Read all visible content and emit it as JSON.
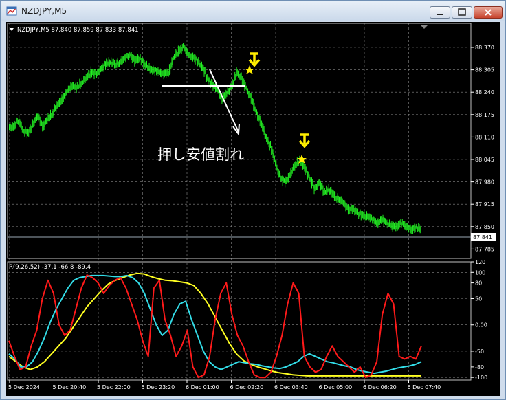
{
  "window": {
    "title": "NZDJPY,M5"
  },
  "main_chart": {
    "ohlc_label": "NZDJPY,M5  87.840 87.859 87.833 87.841",
    "current_price_label": "87.841",
    "price_ticks": [
      "88.370",
      "88.305",
      "88.240",
      "88.175",
      "88.110",
      "88.045",
      "87.980",
      "87.915",
      "87.850",
      "87.785"
    ],
    "annotation_text": "押し安値割れ",
    "colors": {
      "candle": "#22ee22",
      "marker": "#ffff00",
      "grid": "#8a8a8a",
      "annotation": "#ffffff"
    }
  },
  "indicator": {
    "label": "R(9,26,52) -37.1 -66.8 -89.4",
    "ticks": [
      "120",
      "100",
      "80",
      "50",
      "0.00",
      "-50",
      "-80",
      "-100"
    ],
    "colors": {
      "fast": "#ff1a1a",
      "mid": "#33dde8",
      "slow": "#ffff22"
    }
  },
  "time_axis": [
    "5 Dec 2024",
    "5 Dec 20:40",
    "5 Dec 22:00",
    "5 Dec 23:20",
    "6 Dec 01:00",
    "6 Dec 02:20",
    "6 Dec 03:40",
    "6 Dec 05:00",
    "6 Dec 06:20",
    "6 Dec 07:40"
  ],
  "chart_data": {
    "type": "candlestick",
    "title": "NZDJPY,M5",
    "price_range": [
      87.785,
      88.4
    ],
    "close_series": [
      88.14,
      88.16,
      88.13,
      88.12,
      88.15,
      88.17,
      88.14,
      88.16,
      88.18,
      88.2,
      88.22,
      88.24,
      88.26,
      88.25,
      88.27,
      88.28,
      88.3,
      88.29,
      88.31,
      88.32,
      88.33,
      88.32,
      88.33,
      88.34,
      88.35,
      88.33,
      88.34,
      88.32,
      88.31,
      88.3,
      88.3,
      88.29,
      88.3,
      88.34,
      88.36,
      88.37,
      88.35,
      88.34,
      88.33,
      88.31,
      88.28,
      88.26,
      88.25,
      88.22,
      88.24,
      88.26,
      88.3,
      88.28,
      88.25,
      88.22,
      88.18,
      88.15,
      88.11,
      88.08,
      88.03,
      87.99,
      87.98,
      88.0,
      88.03,
      88.04,
      88.02,
      87.99,
      87.96,
      87.98,
      87.95,
      87.96,
      87.94,
      87.93,
      87.92,
      87.9,
      87.9,
      87.89,
      87.88,
      87.88,
      87.87,
      87.86,
      87.87,
      87.86,
      87.85,
      87.85,
      87.86,
      87.85,
      87.84,
      87.85,
      87.84
    ],
    "oscillator_range": [
      -105,
      120
    ],
    "series": [
      {
        "name": "R(9)",
        "values": [
          -30,
          -60,
          -85,
          -80,
          -40,
          -10,
          50,
          85,
          60,
          0,
          -20,
          -10,
          30,
          70,
          95,
          90,
          80,
          60,
          75,
          85,
          90,
          70,
          40,
          10,
          -30,
          -60,
          70,
          85,
          10,
          -20,
          -60,
          -40,
          -10,
          -80,
          -100,
          -95,
          -60,
          10,
          60,
          80,
          20,
          -20,
          -40,
          -70,
          -95,
          -100,
          -100,
          -90,
          -60,
          -20,
          40,
          80,
          60,
          -60,
          -80,
          -90,
          -85,
          -60,
          -40,
          -60,
          -70,
          -80,
          -90,
          -80,
          -100,
          -95,
          -70,
          20,
          60,
          40,
          -60,
          -65,
          -60,
          -65,
          -40
        ]
      },
      {
        "name": "R(26)",
        "values": [
          -55,
          -65,
          -80,
          -80,
          -70,
          -50,
          -25,
          5,
          30,
          50,
          70,
          85,
          90,
          92,
          94,
          94,
          94,
          93,
          92,
          92,
          94,
          90,
          80,
          60,
          30,
          0,
          -20,
          -10,
          20,
          40,
          45,
          10,
          -20,
          -50,
          -70,
          -80,
          -85,
          -80,
          -75,
          -70,
          -72,
          -74,
          -75,
          -78,
          -80,
          -82,
          -83,
          -80,
          -75,
          -70,
          -60,
          -55,
          -60,
          -65,
          -70,
          -72,
          -75,
          -78,
          -80,
          -85,
          -88,
          -90,
          -92,
          -90,
          -88,
          -85,
          -82,
          -80,
          -78,
          -75,
          -70
        ]
      },
      {
        "name": "R(52)",
        "values": [
          -60,
          -70,
          -80,
          -85,
          -80,
          -70,
          -55,
          -40,
          -25,
          -5,
          15,
          35,
          50,
          65,
          78,
          85,
          90,
          95,
          98,
          97,
          92,
          88,
          85,
          84,
          82,
          80,
          75,
          60,
          40,
          15,
          -10,
          -35,
          -55,
          -68,
          -75,
          -80,
          -84,
          -88,
          -91,
          -93,
          -95,
          -96,
          -97,
          -97,
          -97,
          -97,
          -97,
          -97,
          -97,
          -97,
          -97,
          -97,
          -97,
          -97,
          -97,
          -97,
          -97,
          -97,
          -97
        ]
      }
    ]
  }
}
